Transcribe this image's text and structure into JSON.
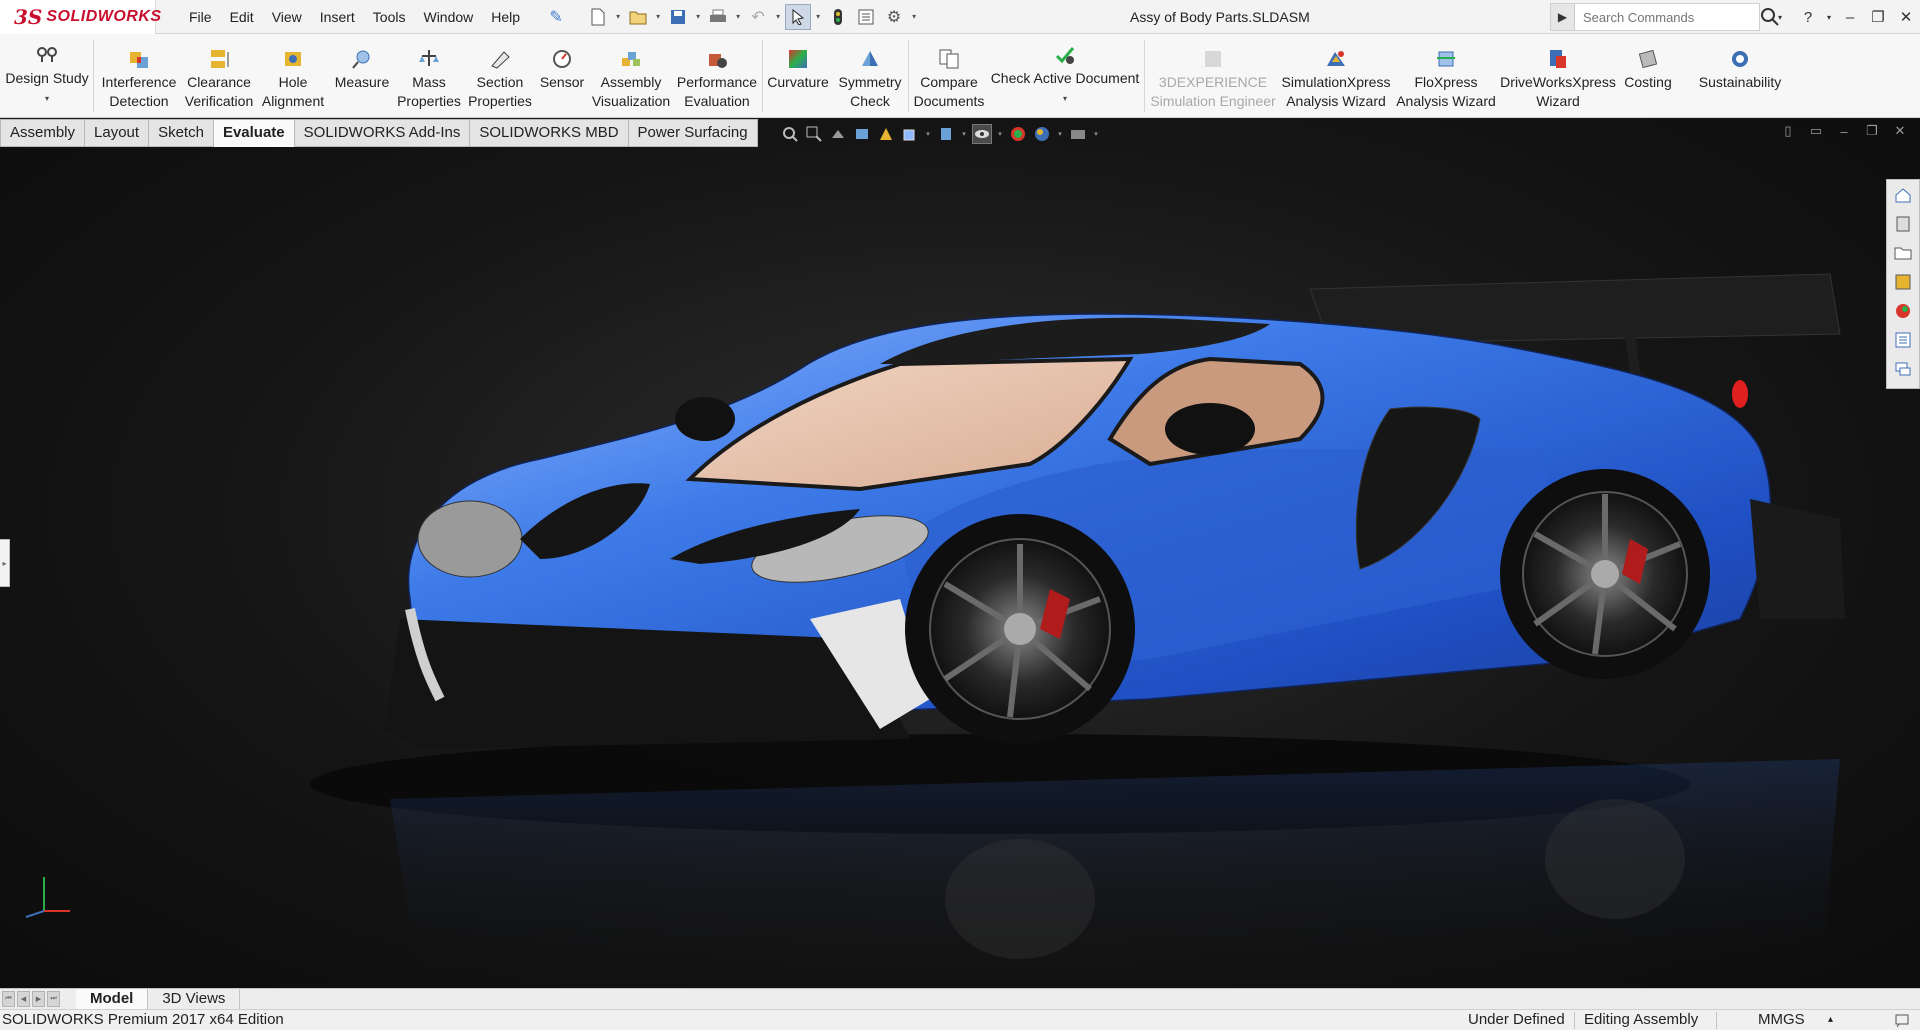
{
  "app": {
    "brand_prefix": "3S",
    "brand_name": "SOLIDWORKS",
    "document_title": "Assy of Body Parts.SLDASM"
  },
  "menu": [
    "File",
    "Edit",
    "View",
    "Insert",
    "Tools",
    "Window",
    "Help"
  ],
  "quick_access_icons": [
    "pin-icon",
    "new-document-icon",
    "open-icon",
    "save-icon",
    "print-icon",
    "undo-icon",
    "select-icon",
    "rebuild-icon",
    "file-properties-icon",
    "options-icon"
  ],
  "search": {
    "placeholder": "Search Commands"
  },
  "ribbon": {
    "design_study": "Design Study",
    "interference": "Interference\nDetection",
    "clearance": "Clearance\nVerification",
    "hole_alignment": "Hole\nAlignment",
    "measure": "Measure",
    "mass_properties": "Mass\nProperties",
    "section_properties": "Section\nProperties",
    "sensor": "Sensor",
    "assembly_visualization": "Assembly\nVisualization",
    "performance_evaluation": "Performance\nEvaluation",
    "curvature": "Curvature",
    "symmetry_check": "Symmetry\nCheck",
    "compare_documents": "Compare\nDocuments",
    "check_active_document": "Check Active Document",
    "simulation_engineer": "3DEXPERIENCE\nSimulation Engineer",
    "simulationxpress": "SimulationXpress\nAnalysis Wizard",
    "floxpress": "FloXpress\nAnalysis Wizard",
    "driveworksxpress": "DriveWorksXpress\nWizard",
    "costing": "Costing",
    "sustainability": "Sustainability"
  },
  "tabs": [
    "Assembly",
    "Layout",
    "Sketch",
    "Evaluate",
    "SOLIDWORKS Add-Ins",
    "SOLIDWORKS MBD",
    "Power Surfacing"
  ],
  "active_tab": "Evaluate",
  "bottom_tabs": {
    "model": "Model",
    "views3d": "3D Views"
  },
  "status": {
    "edition": "SOLIDWORKS Premium 2017 x64 Edition",
    "definition": "Under Defined",
    "mode": "Editing Assembly",
    "units": "MMGS",
    "units_caret": "▴"
  },
  "colors": {
    "brand_red": "#c8102e",
    "car_body_blue": "#2f6bd8",
    "viewport_bg": "#151515"
  },
  "viewport_model": "blue sports car assembly"
}
